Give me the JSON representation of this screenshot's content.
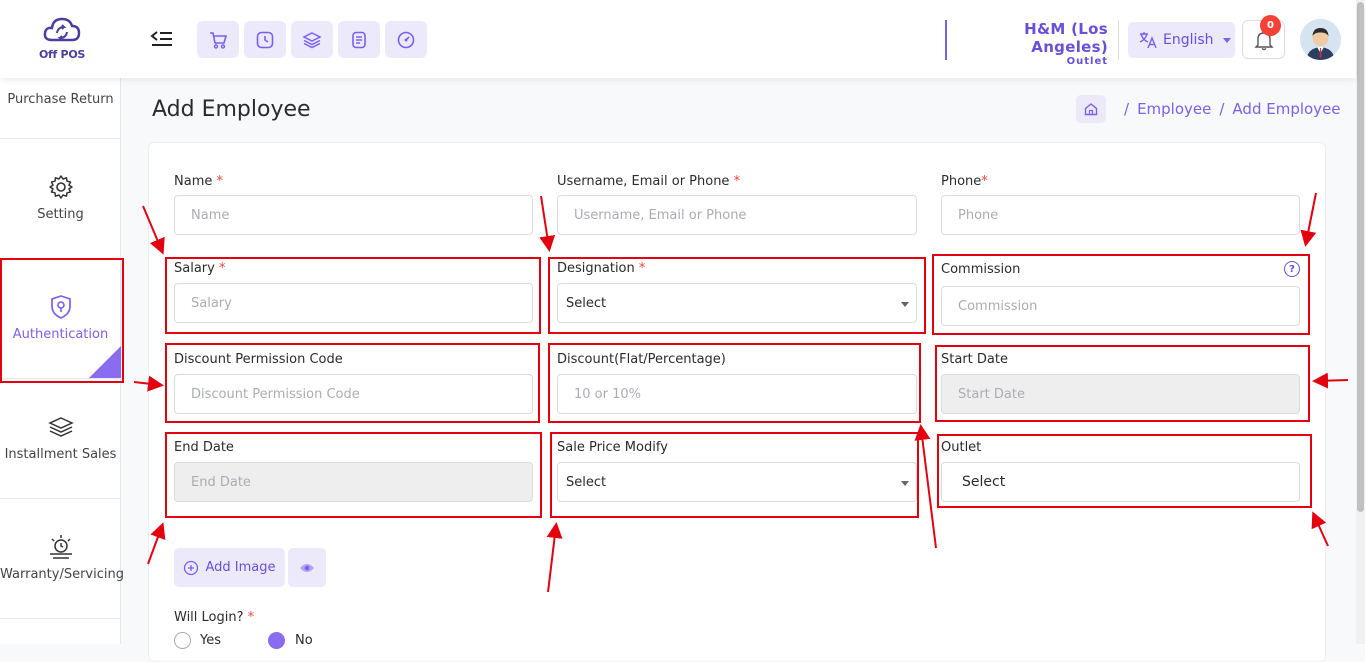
{
  "app": {
    "logo_text": "Off POS"
  },
  "header": {
    "outlet_name": "H&M (Los Angeles)",
    "outlet_label": "Outlet",
    "language": "English",
    "notification_count": "0"
  },
  "sidebar": {
    "items": [
      {
        "label": "Purchase Return",
        "icon": "return-icon"
      },
      {
        "label": "Setting",
        "icon": "gear-icon"
      },
      {
        "label": "Authentication",
        "icon": "shield-icon",
        "active": true
      },
      {
        "label": "Installment Sales",
        "icon": "layers-icon"
      },
      {
        "label": "Warranty/Servicing",
        "icon": "warranty-icon"
      }
    ]
  },
  "page": {
    "title": "Add Employee",
    "breadcrumb": [
      "Employee",
      "Add Employee"
    ]
  },
  "form": {
    "name": {
      "label": "Name",
      "placeholder": "Name"
    },
    "username": {
      "label": "Username, Email or Phone",
      "placeholder": "Username, Email or Phone"
    },
    "phone": {
      "label": "Phone",
      "placeholder": "Phone"
    },
    "salary": {
      "label": "Salary",
      "placeholder": "Salary"
    },
    "designation": {
      "label": "Designation",
      "value": "Select"
    },
    "commission": {
      "label": "Commission",
      "placeholder": "Commission",
      "help": "?"
    },
    "discount_code": {
      "label": "Discount Permission Code",
      "placeholder": "Discount Permission Code"
    },
    "discount": {
      "label": "Discount(Flat/Percentage)",
      "placeholder": "10 or 10%"
    },
    "start_date": {
      "label": "Start Date",
      "placeholder": "Start Date"
    },
    "end_date": {
      "label": "End Date",
      "placeholder": "End Date"
    },
    "sale_price_modify": {
      "label": "Sale Price Modify",
      "value": "Select"
    },
    "outlet": {
      "label": "Outlet",
      "value": "Select"
    },
    "add_image": "Add Image",
    "will_login": {
      "label": "Will Login?",
      "options": [
        "Yes",
        "No"
      ],
      "selected": "No"
    },
    "required_mark": "*"
  },
  "colors": {
    "accent": "#7b61e8",
    "annotation": "#e3000f"
  }
}
